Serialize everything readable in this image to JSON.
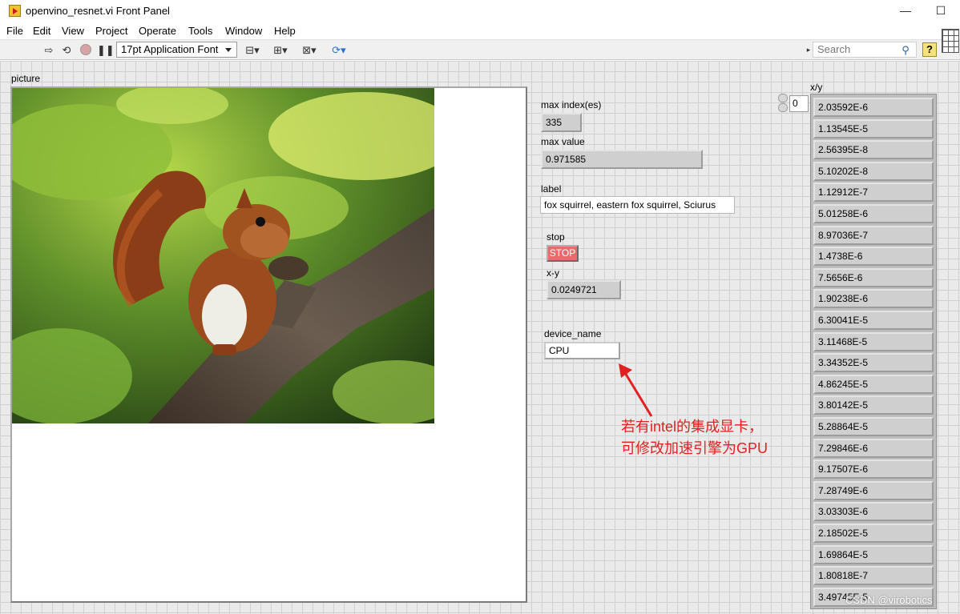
{
  "window": {
    "title": "openvino_resnet.vi Front Panel",
    "controls": [
      "—",
      "☐"
    ]
  },
  "menu": [
    "File",
    "Edit",
    "View",
    "Project",
    "Operate",
    "Tools",
    "Window",
    "Help"
  ],
  "toolbar": {
    "font": "17pt Application Font",
    "search_placeholder": "Search",
    "help": "?"
  },
  "panel": {
    "picture_label": "picture",
    "max_index_label": "max index(es)",
    "max_index_value": "335",
    "max_value_label": "max value",
    "max_value_value": "0.971585",
    "label_label": "label",
    "label_value": "fox squirrel, eastern fox squirrel, Sciurus",
    "stop_label": "stop",
    "stop_button": "STOP",
    "xy_label": "x-y",
    "xy_value": "0.0249721",
    "device_label": "device_name",
    "device_value": "CPU",
    "array_label": "x/y",
    "array_index": "0",
    "array_values": [
      "2.03592E-6",
      "1.13545E-5",
      "2.56395E-8",
      "5.10202E-8",
      "1.12912E-7",
      "5.01258E-6",
      "8.97036E-7",
      "1.4738E-6",
      "7.5656E-6",
      "1.90238E-6",
      "6.30041E-5",
      "3.11468E-5",
      "3.34352E-5",
      "4.86245E-5",
      "3.80142E-5",
      "5.28864E-5",
      "7.29846E-6",
      "9.17507E-6",
      "7.28749E-6",
      "3.03303E-6",
      "2.18502E-5",
      "1.69864E-5",
      "1.80818E-7",
      "3.49745E-5"
    ]
  },
  "annotation": {
    "line1": "若有intel的集成显卡，",
    "line2": "可修改加速引擎为GPU"
  },
  "watermark": "CSDN @virobotics"
}
